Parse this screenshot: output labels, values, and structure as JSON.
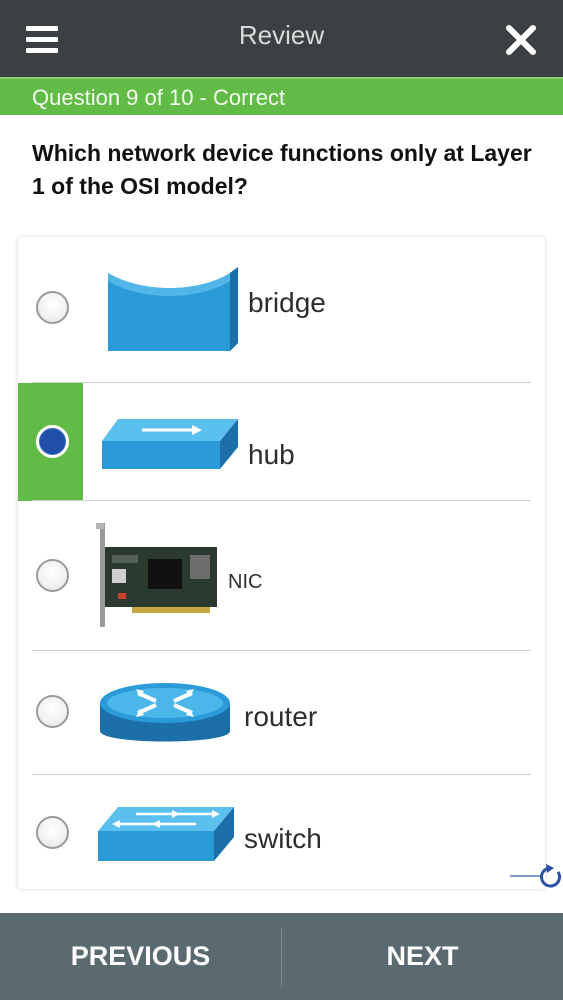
{
  "header": {
    "title": "Review",
    "menu_icon": "hamburger-menu-icon",
    "close_icon": "close-icon",
    "background": "#3b4042"
  },
  "status": {
    "text": "Question 9 of 10 - Correct",
    "color": "#62bb46"
  },
  "question": {
    "text": "Which network device functions only at Layer 1 of the OSI model?"
  },
  "options": [
    {
      "label": "bridge",
      "icon": "bridge-icon",
      "selected": false
    },
    {
      "label": "hub",
      "icon": "hub-icon",
      "selected": true
    },
    {
      "label": "NIC",
      "icon": "nic-card-icon",
      "selected": false
    },
    {
      "label": "router",
      "icon": "router-icon",
      "selected": false
    },
    {
      "label": "switch",
      "icon": "switch-icon",
      "selected": false
    }
  ],
  "footer": {
    "previous_label": "PREVIOUS",
    "next_label": "NEXT",
    "background": "#5b6971"
  },
  "accent_selected": "#1f4fa6",
  "refresh_icon": "refresh-icon"
}
